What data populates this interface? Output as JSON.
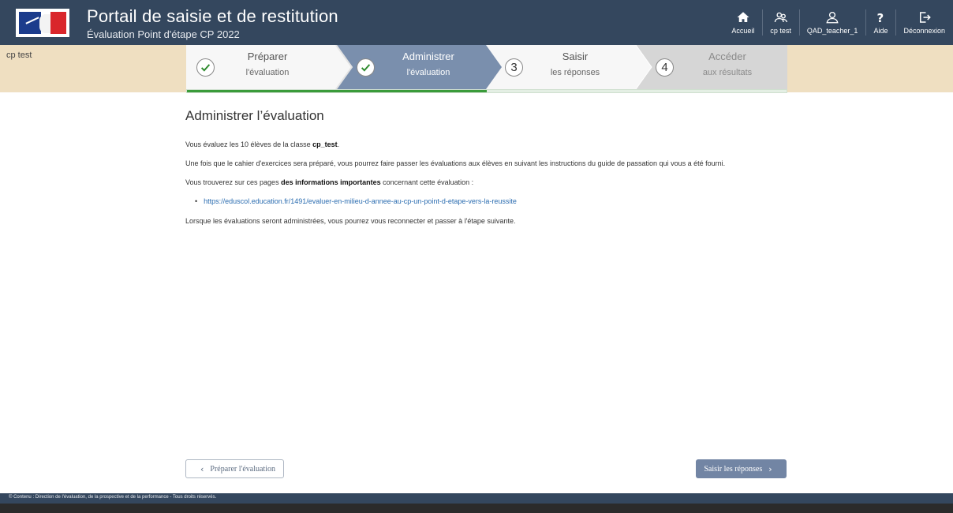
{
  "header": {
    "title": "Portail de saisie et de restitution",
    "subtitle": "Évaluation Point d'étape CP 2022"
  },
  "nav": [
    {
      "icon": "home-icon",
      "label": "Accueil"
    },
    {
      "icon": "group-icon",
      "label": "cp test"
    },
    {
      "icon": "user-icon",
      "label": "QAD_teacher_1"
    },
    {
      "icon": "help-icon",
      "label": "Aide"
    },
    {
      "icon": "logout-icon",
      "label": "Déconnexion"
    }
  ],
  "class_label": "cp test",
  "steps": [
    {
      "num": "1",
      "title": "Préparer",
      "subtitle": "l'évaluation",
      "status": "done"
    },
    {
      "num": "2",
      "title": "Administrer",
      "subtitle": "l'évaluation",
      "status": "current"
    },
    {
      "num": "3",
      "title": "Saisir",
      "subtitle": "les réponses",
      "status": "todo"
    },
    {
      "num": "4",
      "title": "Accéder",
      "subtitle": "aux résultats",
      "status": "locked"
    }
  ],
  "progress_fraction": 0.5,
  "content": {
    "title": "Administrer l’évaluation",
    "p1_prefix": "Vous évaluez les 10 élèves de la classe ",
    "p1_bold": "cp_test",
    "p1_suffix": ".",
    "p2": "Une fois que le cahier d'exercices sera préparé, vous pourrez faire passer les évaluations aux élèves en suivant les instructions du guide de passation qui vous a été fourni.",
    "p3_prefix": "Vous trouverez sur ces pages ",
    "p3_bold": "des informations importantes",
    "p3_suffix": " concernant cette évaluation :",
    "link": "https://eduscol.education.fr/1491/evaluer-en-milieu-d-annee-au-cp-un-point-d-etape-vers-la-reussite",
    "p4": "Lorsque les évaluations seront administrées, vous pourrez vous reconnecter et passer à l'étape suivante."
  },
  "buttons": {
    "prev": "Préparer l'évaluation",
    "next": "Saisir les réponses"
  },
  "footer": "© Contenu : Direction de l'évaluation, de la prospective et de la performance - Tous droits réservés.",
  "colors": {
    "header": "#34475e",
    "band": "#efdfc1",
    "active_step": "#7a8fad",
    "progress": "#3a9b3a",
    "link": "#2a6cb0"
  }
}
